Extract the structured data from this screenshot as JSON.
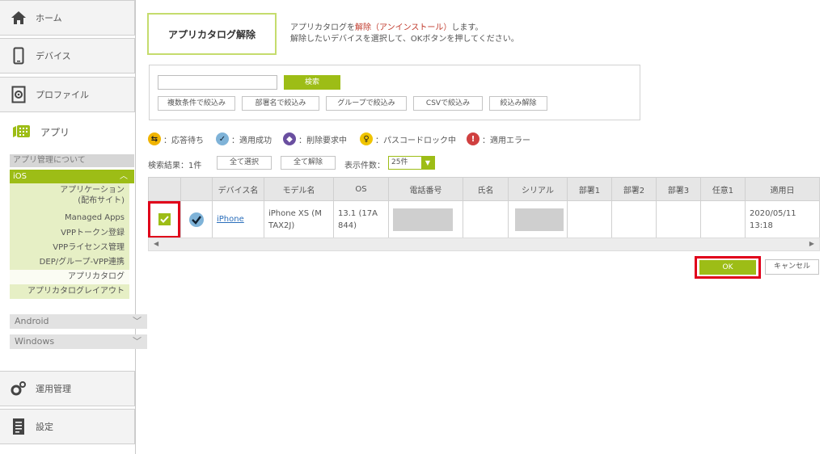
{
  "sidebar": {
    "home": "ホーム",
    "devices": "デバイス",
    "profiles": "プロファイル",
    "apps": "アプリ",
    "about": "アプリ管理について",
    "ios": "iOS",
    "ios_items": [
      {
        "label": "アプリケーション"
      },
      {
        "label": "(配布サイト)"
      },
      {
        "label": "Managed Apps"
      },
      {
        "label": "VPPトークン登録"
      },
      {
        "label": "VPPライセンス管理"
      },
      {
        "label": "DEP/グループ-VPP連携"
      },
      {
        "label": "アプリカタログ"
      },
      {
        "label": "アプリカタログレイアウト"
      }
    ],
    "android": "Android",
    "windows": "Windows",
    "ops": "運用管理",
    "settings": "設定"
  },
  "page": {
    "title": "アプリカタログ解除",
    "desc_a": "アプリカタログを",
    "desc_red": "解除（アンインストール）",
    "desc_b": "します。",
    "desc_line2": "解除したいデバイスを選択して、OKボタンを押してください。"
  },
  "search": {
    "placeholder": "",
    "button": "検索",
    "filters": [
      "複数条件で絞込み",
      "部署名で絞込み",
      "グループで絞込み",
      "CSVで絞込み",
      "絞込み解除"
    ]
  },
  "legend": [
    {
      "label": "：応答待ち",
      "color": "#f0b400",
      "icon": "arrows-icon"
    },
    {
      "label": "：適用成功",
      "color": "#7fb3d8",
      "icon": "check-icon"
    },
    {
      "label": "：削除要求中",
      "color": "#6a4fa0",
      "icon": "delete-icon"
    },
    {
      "label": "：パスコードロック中",
      "color": "#f0c400",
      "icon": "key-icon"
    },
    {
      "label": "：適用エラー",
      "color": "#d04040",
      "icon": "error-icon"
    }
  ],
  "results": {
    "label": "検索結果：1件",
    "select_all": "全て選択",
    "clear_all": "全て解除",
    "count_label": "表示件数：",
    "count_value": "25件"
  },
  "table": {
    "headers": [
      "",
      "",
      "デバイス名",
      "モデル名",
      "OS",
      "電話番号",
      "氏名",
      "シリアル",
      "部署1",
      "部署2",
      "部署3",
      "任意1",
      "適用日"
    ],
    "row": {
      "device": "iPhone",
      "model": "iPhone XS (M TAX2J)",
      "os": "13.1 (17A 844)",
      "date": "2020/05/11 13:18"
    }
  },
  "actions": {
    "ok": "OK",
    "cancel": "キャンセル"
  },
  "colors": {
    "accent": "#9dbd16",
    "highlight": "#e0001a"
  }
}
